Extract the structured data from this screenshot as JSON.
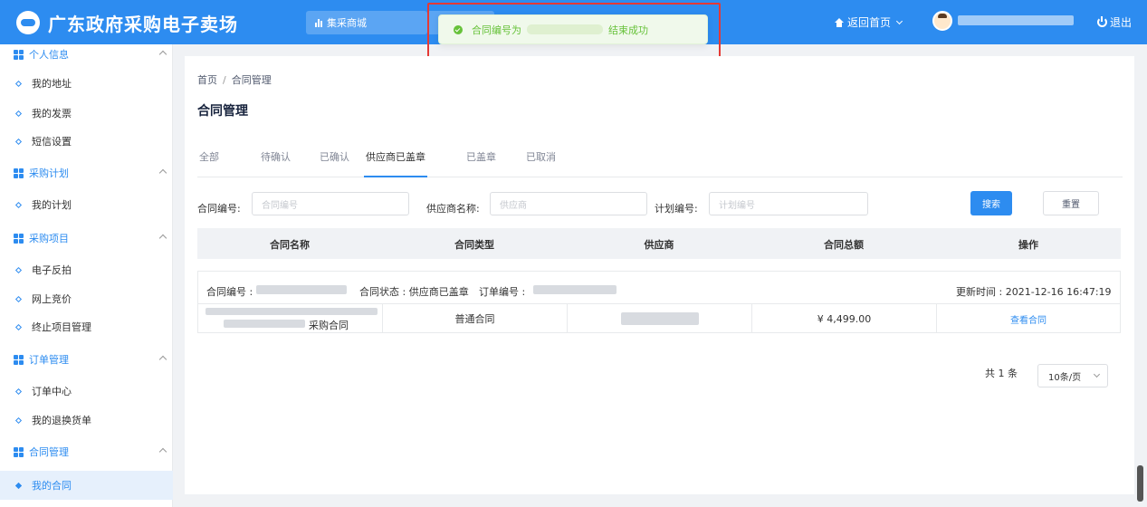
{
  "header": {
    "site_title": "广东政府采购电子卖场",
    "mall_tab": "集采商城",
    "home_link": "返回首页",
    "logout": "退出"
  },
  "toast": {
    "prefix": "合同编号为",
    "suffix": "结束成功",
    "status_color": "#67c23a"
  },
  "sidebar": {
    "groups": [
      {
        "title": "个人信息",
        "items": [
          "我的地址",
          "我的发票",
          "短信设置"
        ]
      },
      {
        "title": "采购计划",
        "items": [
          "我的计划"
        ]
      },
      {
        "title": "采购项目",
        "items": [
          "电子反拍",
          "网上竞价",
          "终止项目管理"
        ]
      },
      {
        "title": "订单管理",
        "items": [
          "订单中心",
          "我的退换货单"
        ]
      },
      {
        "title": "合同管理",
        "items": [
          "我的合同"
        ]
      }
    ],
    "active_item": "我的合同"
  },
  "main": {
    "breadcrumb": [
      "首页",
      "合同管理"
    ],
    "title": "合同管理",
    "tabs": [
      "全部",
      "待确认",
      "已确认",
      "供应商已盖章",
      "已盖章",
      "已取消"
    ],
    "active_tab": "供应商已盖章",
    "filters": {
      "contract_no_label": "合同编号:",
      "contract_no_placeholder": "合同编号",
      "supplier_label": "供应商名称:",
      "supplier_placeholder": "供应商",
      "plan_no_label": "计划编号:",
      "plan_no_placeholder": "计划编号",
      "search_button": "搜索",
      "reset_button": "重置"
    },
    "table": {
      "columns": [
        "合同名称",
        "合同类型",
        "供应商",
        "合同总额",
        "操作"
      ],
      "rows": [
        {
          "contract_no_label": "合同编号 : ",
          "status_label": "合同状态 : 供应商已盖章",
          "order_no_label": "订单编号 : ",
          "updated": "更新时间 : 2021-12-16 16:47:19",
          "name_suffix": "采购合同",
          "type": "普通合同",
          "amount": "¥ 4,499.00",
          "action": "查看合同"
        }
      ]
    },
    "pagination": {
      "total": "共 1 条",
      "page_size": "10条/页"
    }
  },
  "colors": {
    "brand": "#2d8cf0",
    "success": "#67c23a",
    "highlight_border": "#e53935"
  }
}
